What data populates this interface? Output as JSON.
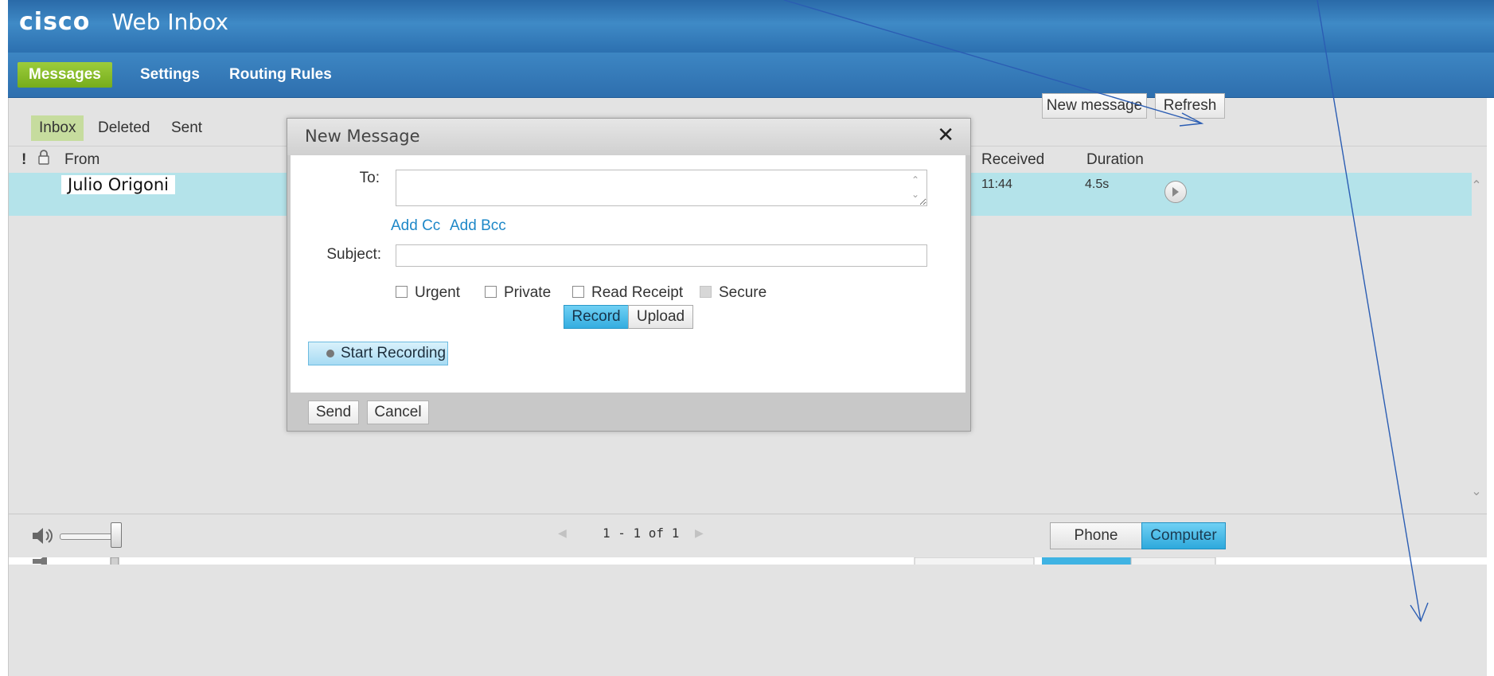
{
  "header": {
    "logo": "cisco",
    "app_title": "Web Inbox"
  },
  "nav": {
    "tabs": [
      {
        "label": "Messages",
        "active": true
      },
      {
        "label": "Settings"
      },
      {
        "label": "Routing Rules"
      }
    ]
  },
  "folders": {
    "items": [
      {
        "label": "Inbox",
        "active": true
      },
      {
        "label": "Deleted"
      },
      {
        "label": "Sent"
      }
    ]
  },
  "toolbar": {
    "new_message": "New message",
    "refresh": "Refresh"
  },
  "columns": {
    "urgent": "!",
    "from": "From",
    "received": "Received",
    "duration": "Duration"
  },
  "messages": [
    {
      "from": "Julio Origoni",
      "received": "11:44",
      "duration": "4.5s"
    }
  ],
  "footer": {
    "pager": "1 - 1 of 1",
    "playback": {
      "phone": "Phone",
      "computer": "Computer",
      "selected": "Computer"
    }
  },
  "dialog": {
    "title": "New Message",
    "to_label": "To:",
    "to_value": "",
    "add_cc": "Add Cc",
    "add_bcc": "Add Bcc",
    "subject_label": "Subject:",
    "subject_value": "",
    "options": {
      "urgent": "Urgent",
      "private": "Private",
      "read_receipt": "Read Receipt",
      "secure": "Secure"
    },
    "mode": {
      "record": "Record",
      "upload": "Upload",
      "selected": "Record"
    },
    "start_recording": "Start Recording",
    "send": "Send",
    "cancel": "Cancel"
  },
  "colors": {
    "header_blue": "#2f77b6",
    "active_tab_green": "#8bc12a",
    "selection_cyan": "#b4e3ea",
    "toggle_on_blue": "#3fb3e3",
    "annotation_arrow": "#2b5db3"
  }
}
